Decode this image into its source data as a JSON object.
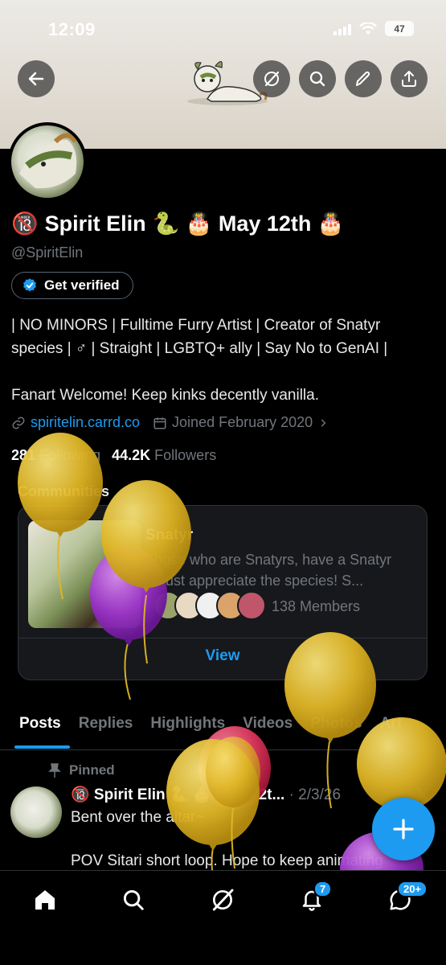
{
  "status_bar": {
    "time": "12:09",
    "battery": "47"
  },
  "header": {
    "back_icon": "arrow-left-icon",
    "grok_icon": "grok-icon",
    "search_icon": "search-icon",
    "edit_icon": "pencil-icon",
    "share_icon": "share-icon"
  },
  "profile": {
    "name_prefix": "🔞",
    "name": "Spirit Elin",
    "name_suffix": "🐍 🎂 May 12th 🎂",
    "handle": "@SpiritElin",
    "verified_label": "Get verified",
    "bio_line1": "| NO MINORS | Fulltime Furry Artist | Creator of Snatyr",
    "bio_line2": "species | ♂ | Straight | LGBTQ+ ally | Say No to GenAI |",
    "bio_line3": "Fanart Welcome! Keep kinks decently vanilla.",
    "link": "spiritelin.carrd.co",
    "joined": "Joined February 2020",
    "following_count": "281",
    "following_label": "Following",
    "followers_count": "44.2K",
    "followers_label": "Followers"
  },
  "communities": {
    "label": "Communities",
    "card": {
      "name": "Snatyr",
      "desc_line1": "Those who are Snatyrs, have a Snatyr",
      "desc_line2": "or just appreciate the species! S...",
      "members": "138 Members",
      "view_label": "View"
    }
  },
  "tabs": [
    "Posts",
    "Replies",
    "Highlights",
    "Videos",
    "Photos",
    "Art"
  ],
  "post": {
    "pinned_label": "Pinned",
    "author": "🔞 Spirit Elin 🐍 🎂 May 12t...",
    "date": "· 2/3/26",
    "line1": "Bent over the altar~",
    "line2": "POV Sitari short loop. Hope to keep animating"
  },
  "nav": {
    "notifications_badge": "7",
    "messages_badge": "20+"
  },
  "colors": {
    "accent": "#1d9bf0",
    "background": "#000000",
    "muted": "#71767b"
  }
}
